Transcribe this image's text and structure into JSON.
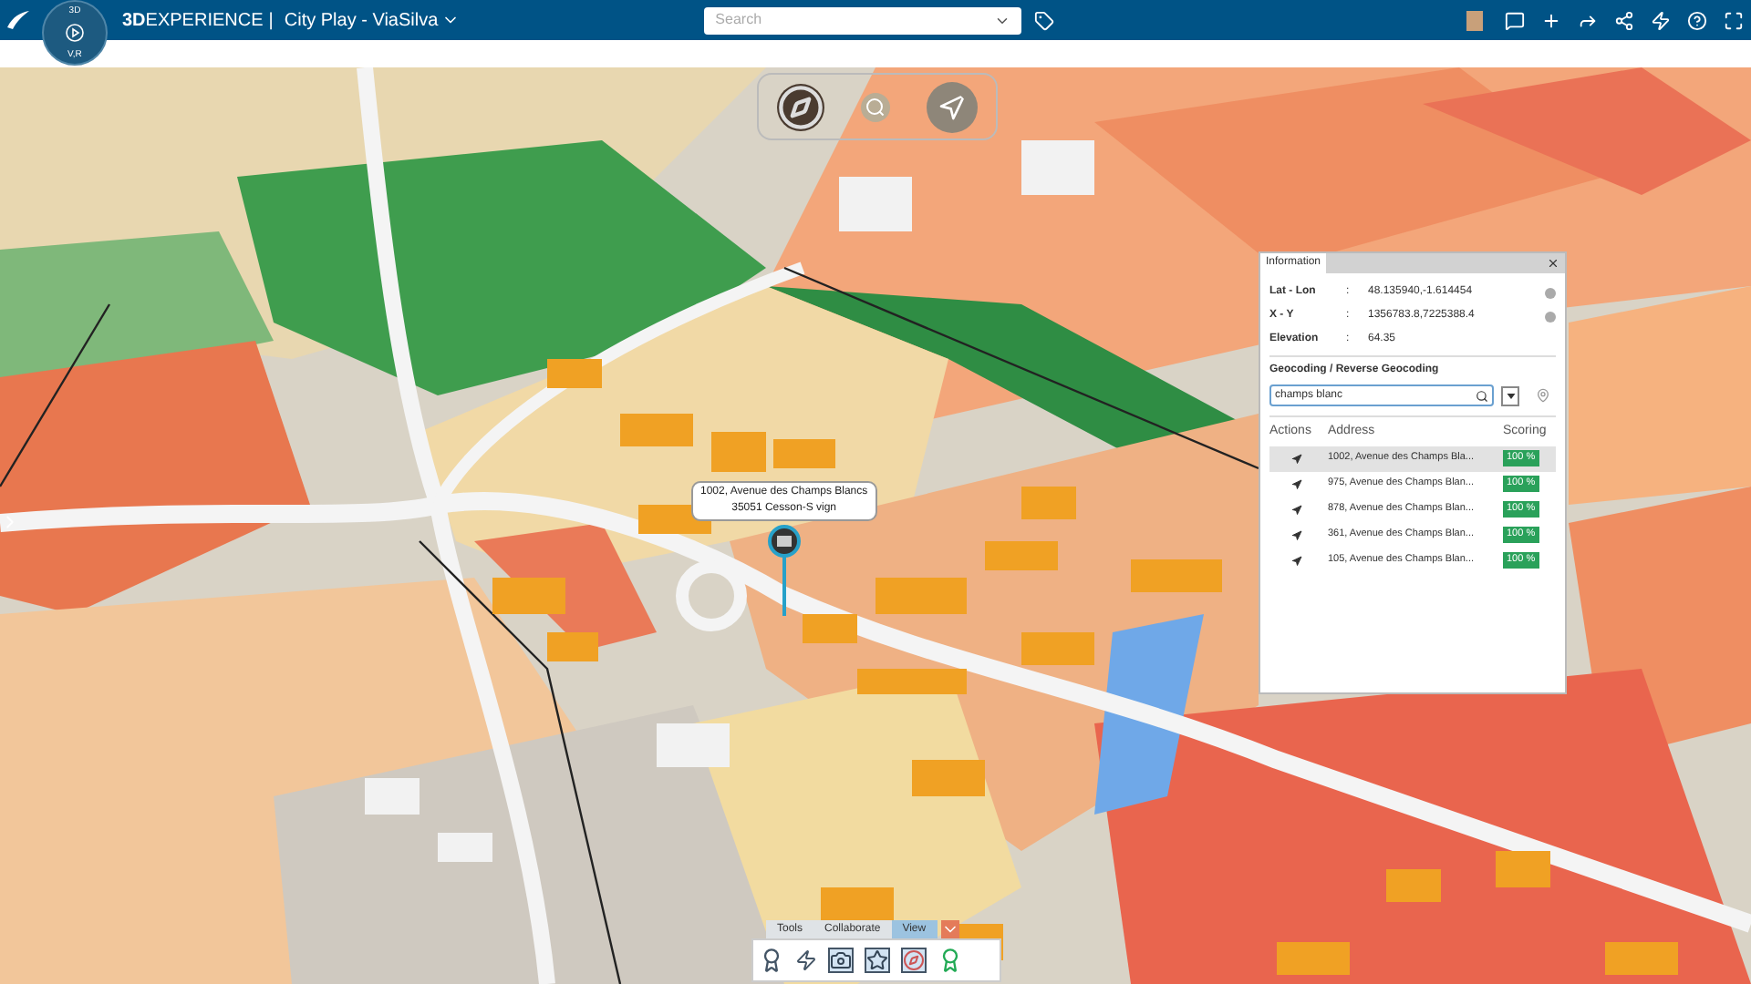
{
  "header": {
    "brand": "3DEXPERIENCE",
    "separator": "|",
    "app_title": "City Play - ViaSilva",
    "search": {
      "placeholder": "Search"
    }
  },
  "compass": {
    "top_label": "3D",
    "bottom_label": "V,R"
  },
  "info_panel": {
    "tab": "Information",
    "fields": [
      {
        "label": "Lat - Lon",
        "sep": ":",
        "value": "48.135940,-1.614454"
      },
      {
        "label": "X - Y",
        "sep": ":",
        "value": "1356783.8,7225388.4"
      },
      {
        "label": "Elevation",
        "sep": ":",
        "value": "64.35"
      }
    ],
    "geocoding_title": "Geocoding / Reverse Geocoding",
    "geocoding_search": {
      "value": "champs blanc"
    },
    "columns": [
      "Actions",
      "Address",
      "Scoring"
    ],
    "results": [
      {
        "address": "1002, Avenue des Champs Bla...",
        "score": "100 %",
        "selected": true
      },
      {
        "address": "975, Avenue des Champs Blan...",
        "score": "100 %",
        "selected": false
      },
      {
        "address": "878, Avenue des Champs Blan...",
        "score": "100 %",
        "selected": false
      },
      {
        "address": "361, Avenue des Champs Blan...",
        "score": "100 %",
        "selected": false
      },
      {
        "address": "105, Avenue des Champs Blan...",
        "score": "100 %",
        "selected": false
      }
    ]
  },
  "map_popup": {
    "line1": "1002, Avenue des Champs Blancs",
    "line2": "35051 Cesson-S vign"
  },
  "toolbar": {
    "tabs": [
      {
        "label": "Tools",
        "selected": false
      },
      {
        "label": "Collaborate",
        "selected": false
      },
      {
        "label": "View",
        "selected": true
      }
    ]
  }
}
